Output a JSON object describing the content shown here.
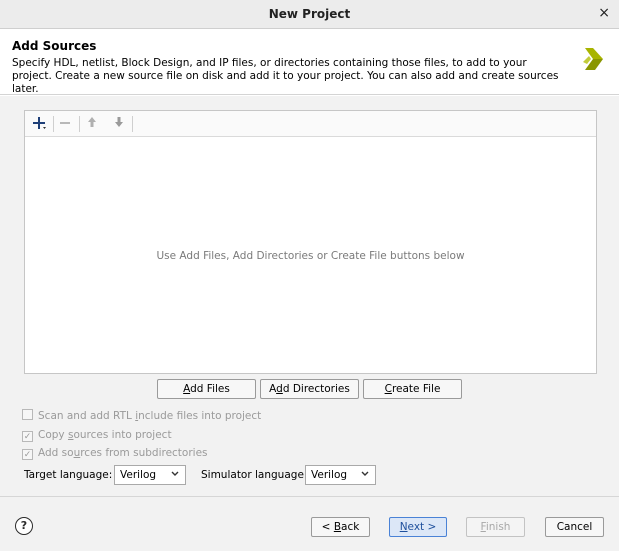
{
  "window": {
    "title": "New Project",
    "close_glyph": "×"
  },
  "header": {
    "title": "Add Sources",
    "description": "Specify HDL, netlist, Block Design, and IP files, or directories containing those files, to add to your project. Create a new source file on disk and add it to your project. You can also add and create sources later."
  },
  "toolbar": {
    "icons": [
      "plus-icon",
      "minus-icon",
      "arrow-up-icon",
      "arrow-down-icon"
    ]
  },
  "file_list": {
    "empty_message": "Use Add Files, Add Directories or Create File buttons below"
  },
  "buttons": {
    "add_files": {
      "pre": "",
      "ul": "A",
      "post": "dd Files"
    },
    "add_directories": {
      "pre": "A",
      "ul": "d",
      "post": "d Directories"
    },
    "create_file": {
      "pre": "",
      "ul": "C",
      "post": "reate File"
    }
  },
  "options": {
    "scan_rtl": {
      "pre": "Scan and add RTL ",
      "ul": "i",
      "post": "nclude files into project",
      "checked": false
    },
    "copy_sources": {
      "pre": "Copy ",
      "ul": "s",
      "post": "ources into project",
      "checked": true
    },
    "add_subdirs": {
      "pre": "Add so",
      "ul": "u",
      "post": "rces from subdirectories",
      "checked": true
    }
  },
  "language": {
    "target_label": "Target language:",
    "target_value": "Verilog",
    "simulator_label": "Simulator language:",
    "simulator_value": "Verilog"
  },
  "footer": {
    "help_glyph": "?",
    "back": {
      "pre": "< ",
      "ul": "B",
      "post": "ack"
    },
    "next": {
      "pre": "",
      "ul": "N",
      "post": "ext >"
    },
    "finish": {
      "pre": "",
      "ul": "F",
      "post": "inish"
    },
    "cancel": "Cancel"
  },
  "colors": {
    "accent": "#4a82d6",
    "logo": "#a8b400"
  }
}
